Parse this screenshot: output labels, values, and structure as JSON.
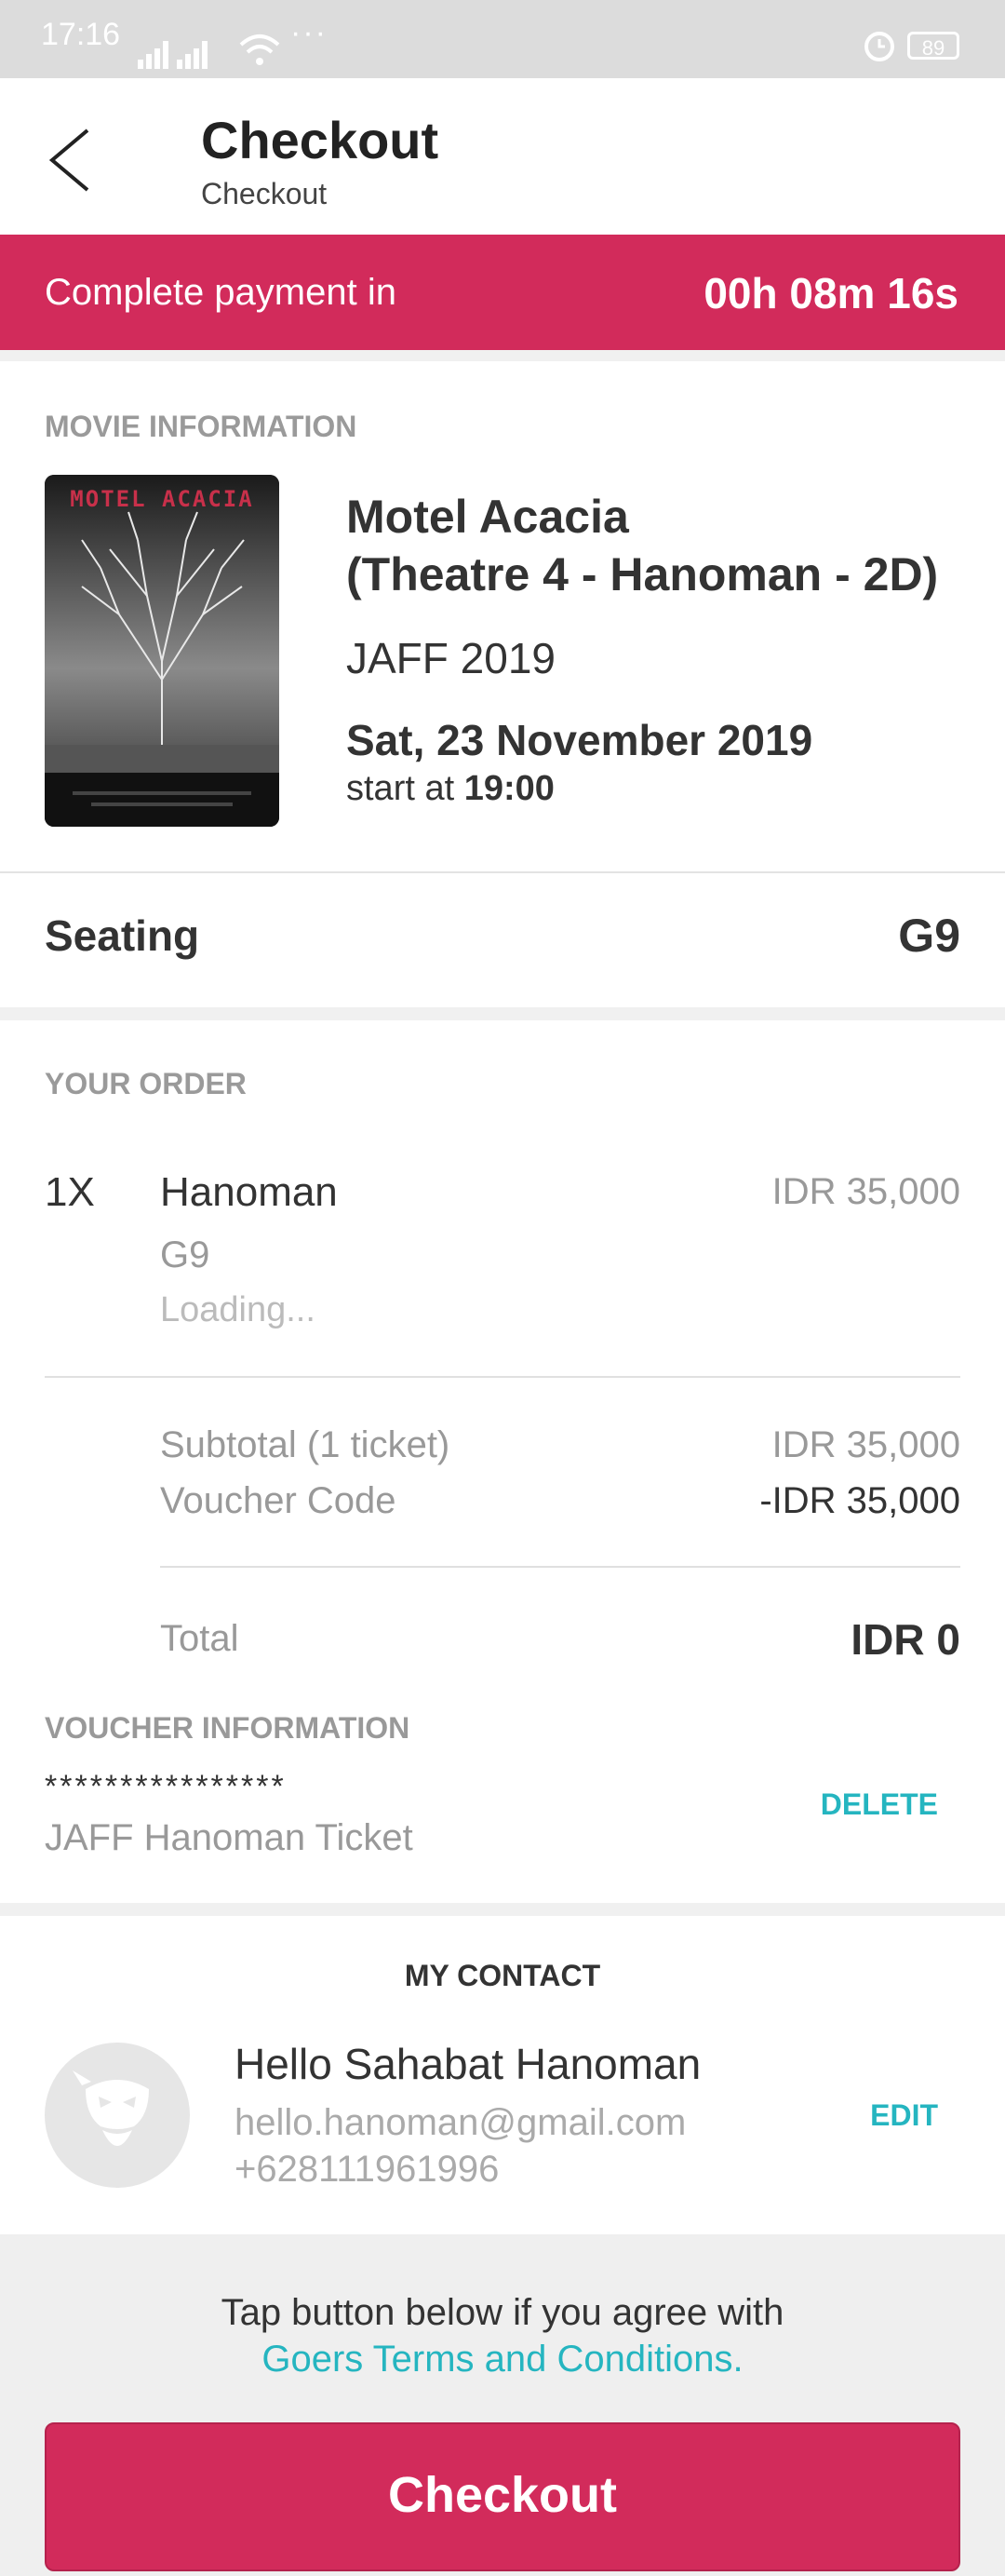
{
  "status_bar": {
    "time": "17:16",
    "dots": "···",
    "battery": "89"
  },
  "header": {
    "title": "Checkout",
    "subtitle": "Checkout"
  },
  "timer": {
    "label": "Complete payment in",
    "value": "00h 08m 16s"
  },
  "movie": {
    "section_label": "MOVIE INFORMATION",
    "poster_title": "MOTEL ACACIA",
    "title_line1": "Motel Acacia",
    "title_line2": "(Theatre 4 - Hanoman - 2D)",
    "event": "JAFF 2019",
    "date": "Sat, 23 November 2019",
    "start_prefix": "start at",
    "start_time": "19:00"
  },
  "seating": {
    "label": "Seating",
    "value": "G9"
  },
  "order": {
    "section_label": "YOUR ORDER",
    "qty": "1X",
    "item_name": "Hanoman",
    "item_price": "IDR 35,000",
    "item_seat": "G9",
    "loading": "Loading...",
    "subtotal_label": "Subtotal (1 ticket)",
    "subtotal_value": "IDR 35,000",
    "voucher_label": "Voucher Code",
    "voucher_value": "-IDR 35,000",
    "total_label": "Total",
    "total_value": "IDR 0"
  },
  "voucher": {
    "section_label": "VOUCHER INFORMATION",
    "code": "****************",
    "name": "JAFF Hanoman Ticket",
    "delete_label": "DELETE"
  },
  "contact": {
    "title": "MY CONTACT",
    "name": "Hello Sahabat Hanoman",
    "email": "hello.hanoman@gmail.com",
    "phone": "+628111961996",
    "edit_label": "EDIT"
  },
  "footer": {
    "agree_text": "Tap button below if you agree with",
    "terms_link": "Goers Terms and Conditions.",
    "checkout_label": "Checkout"
  },
  "colors": {
    "accent": "#d22b5b",
    "link": "#25b5c0",
    "status_bar": "#dcdcdc"
  }
}
